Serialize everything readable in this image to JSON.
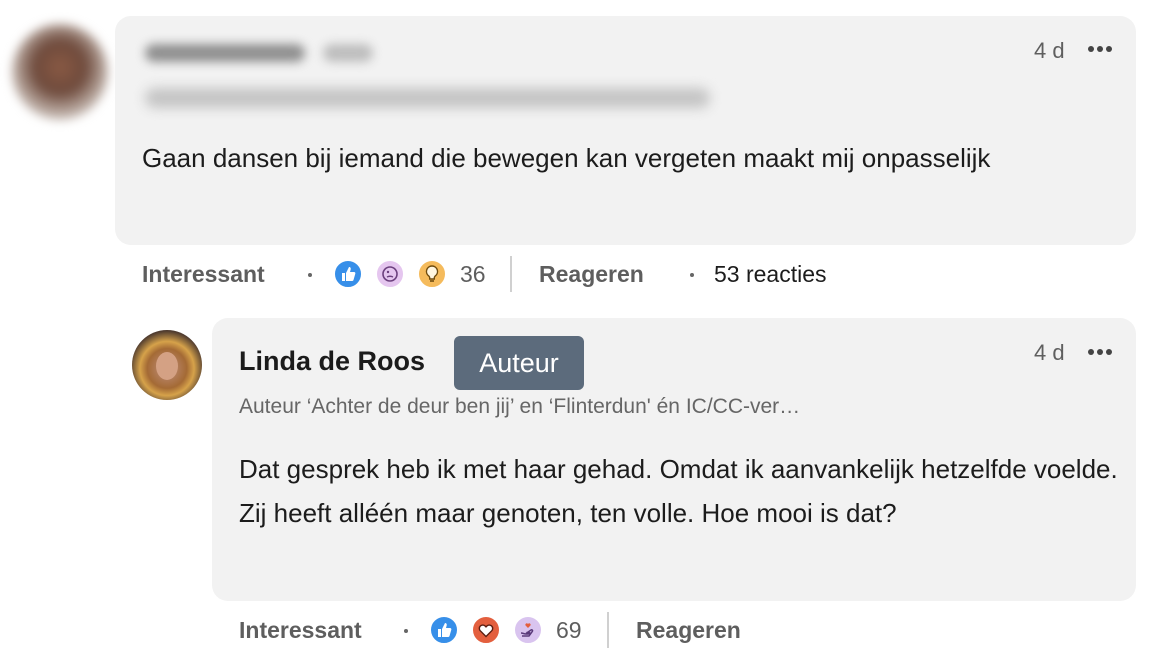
{
  "comment": {
    "time": "4 d",
    "text": "Gaan dansen bij iemand die bewegen kan vergeten maakt mij onpasselijk",
    "actions": {
      "like_label": "Interessant",
      "reaction_icons": [
        "like-icon",
        "curious-icon",
        "insightful-icon"
      ],
      "reaction_count": "36",
      "reply_label": "Reageren",
      "replies_label": "53 reacties"
    }
  },
  "reply": {
    "author_name": "Linda de Roos",
    "author_badge": "Auteur",
    "author_headline": "Auteur ‘Achter de deur ben jij’ en ‘Flinterdun' én IC/CC-ver…",
    "time": "4 d",
    "text": "Dat gesprek heb ik met haar gehad. Omdat ik aanvankelijk hetzelfde voelde. Zij heeft alléén maar genoten, ten volle. Hoe mooi is dat?",
    "actions": {
      "like_label": "Interessant",
      "reaction_icons": [
        "like-icon",
        "love-icon",
        "support-icon"
      ],
      "reaction_count": "69",
      "reply_label": "Reageren"
    }
  },
  "colors": {
    "bubble": "#f2f2f2",
    "badge": "#5c6b7c",
    "like": "#378fe9",
    "love": "#e35f3e",
    "insight": "#f5bb5c"
  }
}
